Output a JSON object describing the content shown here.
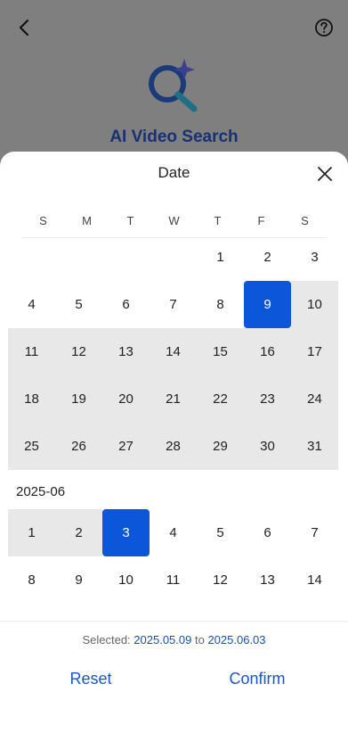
{
  "background": {
    "title": "AI Video Search"
  },
  "sheet": {
    "title": "Date"
  },
  "weekdays": [
    "S",
    "M",
    "T",
    "W",
    "T",
    "F",
    "S"
  ],
  "month1": {
    "rows": [
      [
        "",
        "",
        "",
        "",
        "1",
        "2",
        "3"
      ],
      [
        "4",
        "5",
        "6",
        "7",
        "8",
        "9",
        "10"
      ],
      [
        "11",
        "12",
        "13",
        "14",
        "15",
        "16",
        "17"
      ],
      [
        "18",
        "19",
        "20",
        "21",
        "22",
        "23",
        "24"
      ],
      [
        "25",
        "26",
        "27",
        "28",
        "29",
        "30",
        "31"
      ]
    ],
    "selected_start": "9"
  },
  "month2": {
    "label": "2025-06",
    "rows": [
      [
        "1",
        "2",
        "3",
        "4",
        "5",
        "6",
        "7"
      ],
      [
        "8",
        "9",
        "10",
        "11",
        "12",
        "13",
        "14"
      ]
    ],
    "selected_end": "3"
  },
  "footer": {
    "selected_prefix": "Selected:",
    "start_date": "2025.05.09",
    "to_word": "to",
    "end_date": "2025.06.03",
    "reset_label": "Reset",
    "confirm_label": "Confirm"
  },
  "colors": {
    "accent": "#0b56d9",
    "range": "#e8e8e8",
    "link": "#1a56c8"
  }
}
